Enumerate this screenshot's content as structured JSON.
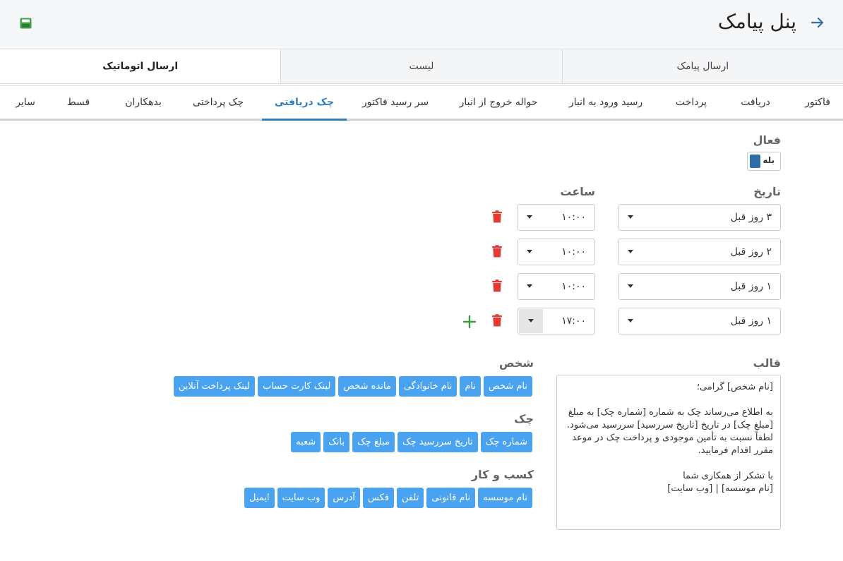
{
  "header": {
    "title": "پنل پیامک",
    "back_icon": "arrow-right-icon",
    "save_icon": "save-icon"
  },
  "main_tabs": [
    {
      "label": "ارسال پیامک"
    },
    {
      "label": "لیست"
    },
    {
      "label": "ارسال اتوماتیک"
    }
  ],
  "sub_tabs": [
    {
      "label": "فاکتور"
    },
    {
      "label": "دریافت"
    },
    {
      "label": "پرداخت"
    },
    {
      "label": "رسید ورود به انبار"
    },
    {
      "label": "حواله خروج از انبار"
    },
    {
      "label": "سر رسید فاکتور"
    },
    {
      "label": "چک دریافتی"
    },
    {
      "label": "چک پرداختی"
    },
    {
      "label": "بدهکاران"
    },
    {
      "label": "قسط"
    },
    {
      "label": "سایر"
    }
  ],
  "active": {
    "label": "فعال",
    "toggle_text": "بله"
  },
  "schedule": {
    "date_label": "تاریخ",
    "time_label": "ساعت",
    "rows": [
      {
        "date": "۳ روز قبل",
        "time": "۱۰:۰۰"
      },
      {
        "date": "۲ روز قبل",
        "time": "۱۰:۰۰"
      },
      {
        "date": "۱ روز قبل",
        "time": "۱۰:۰۰"
      },
      {
        "date": "۱ روز قبل",
        "time": "۱۷:۰۰"
      }
    ]
  },
  "template": {
    "label": "قالب",
    "text": "[نام شخص] گرامی؛\n\nبه اطلاع می‌رساند چک به شماره [شماره چک] به مبلغ [مبلغ چک] در تاریخ [تاریخ سررسید] سررسید می‌شود. لطفاً نسبت به تأمین موجودی و پرداخت چک در موعد مقرر اقدام فرمایید.\n\nبا تشکر از همکاری شما\n[نام موسسه] | [وب سایت]"
  },
  "groups": [
    {
      "label": "شخص",
      "chips": [
        "نام شخص",
        "نام",
        "نام خانوادگی",
        "مانده شخص",
        "لینک کارت حساب",
        "لینک پرداخت آنلاین"
      ]
    },
    {
      "label": "چک",
      "chips": [
        "شماره چک",
        "تاریخ سررسید چک",
        "مبلغ چک",
        "بانک",
        "شعبه"
      ]
    },
    {
      "label": "کسب و کار",
      "chips": [
        "نام موسسه",
        "نام قانونی",
        "تلفن",
        "فکس",
        "آدرس",
        "وب سایت",
        "ایمیل"
      ]
    }
  ]
}
